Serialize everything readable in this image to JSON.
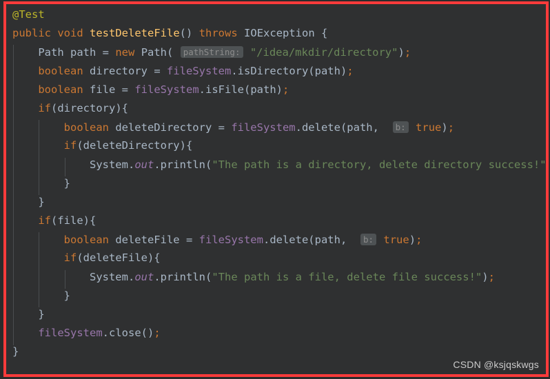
{
  "editor": {
    "language": "Java",
    "theme": "Darcula",
    "frame_color": "#fb3b3b",
    "background": "#2f3031",
    "page_background": "#2b2b2b"
  },
  "colors": {
    "annotation": "#bbb529",
    "keyword": "#cc7832",
    "method": "#ffc66d",
    "identifier": "#a9b7c6",
    "field": "#9876aa",
    "string": "#6a8759",
    "hint_background": "#4e5254",
    "hint_text": "#8c8c8c",
    "indent_guide": "#4b4e50"
  },
  "watermark": {
    "text": "CSDN @ksjqskwgs"
  },
  "code": {
    "lines": [
      {
        "indent": 0,
        "tokens": [
          {
            "t": "@Test",
            "c": "tok-annotation"
          }
        ]
      },
      {
        "indent": 0,
        "tokens": [
          {
            "t": "public",
            "c": "tok-keyword"
          },
          {
            "t": " ",
            "c": "tok-punct"
          },
          {
            "t": "void",
            "c": "tok-keyword"
          },
          {
            "t": " ",
            "c": "tok-punct"
          },
          {
            "t": "testDeleteFile",
            "c": "tok-method"
          },
          {
            "t": "()",
            "c": "tok-punct"
          },
          {
            "t": " ",
            "c": "tok-punct"
          },
          {
            "t": "throws",
            "c": "tok-keyword"
          },
          {
            "t": " ",
            "c": "tok-punct"
          },
          {
            "t": "IOException",
            "c": "tok-type"
          },
          {
            "t": " {",
            "c": "tok-punct"
          }
        ]
      },
      {
        "indent": 1,
        "tokens": [
          {
            "t": "Path",
            "c": "tok-type"
          },
          {
            "t": " path ",
            "c": "tok-ident"
          },
          {
            "t": "=",
            "c": "tok-op"
          },
          {
            "t": " ",
            "c": "tok-punct"
          },
          {
            "t": "new",
            "c": "tok-keyword"
          },
          {
            "t": " ",
            "c": "tok-punct"
          },
          {
            "t": "Path",
            "c": "tok-type"
          },
          {
            "t": "(",
            "c": "tok-punct"
          },
          {
            "t": " ",
            "c": "tok-punct"
          },
          {
            "t": "pathString:",
            "c": "hint"
          },
          {
            "t": " ",
            "c": "tok-punct"
          },
          {
            "t": "\"/idea/mkdir/directory\"",
            "c": "tok-string"
          },
          {
            "t": ")",
            "c": "tok-punct"
          },
          {
            "t": ";",
            "c": "tok-semi"
          }
        ]
      },
      {
        "indent": 1,
        "tokens": [
          {
            "t": "boolean",
            "c": "tok-keyword"
          },
          {
            "t": " directory ",
            "c": "tok-ident"
          },
          {
            "t": "=",
            "c": "tok-op"
          },
          {
            "t": " ",
            "c": "tok-punct"
          },
          {
            "t": "fileSystem",
            "c": "tok-field"
          },
          {
            "t": ".isDirectory(path)",
            "c": "tok-ident"
          },
          {
            "t": ";",
            "c": "tok-semi"
          }
        ]
      },
      {
        "indent": 1,
        "tokens": [
          {
            "t": "boolean",
            "c": "tok-keyword"
          },
          {
            "t": " file ",
            "c": "tok-ident"
          },
          {
            "t": "=",
            "c": "tok-op"
          },
          {
            "t": " ",
            "c": "tok-punct"
          },
          {
            "t": "fileSystem",
            "c": "tok-field"
          },
          {
            "t": ".isFile(path)",
            "c": "tok-ident"
          },
          {
            "t": ";",
            "c": "tok-semi"
          }
        ]
      },
      {
        "indent": 1,
        "tokens": [
          {
            "t": "if",
            "c": "tok-keyword"
          },
          {
            "t": "(directory){",
            "c": "tok-ident"
          }
        ]
      },
      {
        "indent": 2,
        "tokens": [
          {
            "t": "boolean",
            "c": "tok-keyword"
          },
          {
            "t": " deleteDirectory ",
            "c": "tok-ident"
          },
          {
            "t": "=",
            "c": "tok-op"
          },
          {
            "t": " ",
            "c": "tok-punct"
          },
          {
            "t": "fileSystem",
            "c": "tok-field"
          },
          {
            "t": ".delete(path,",
            "c": "tok-ident"
          },
          {
            "t": "  ",
            "c": "tok-punct"
          },
          {
            "t": "b:",
            "c": "hint"
          },
          {
            "t": " ",
            "c": "tok-punct"
          },
          {
            "t": "true",
            "c": "tok-keyword"
          },
          {
            "t": ")",
            "c": "tok-punct"
          },
          {
            "t": ";",
            "c": "tok-semi"
          }
        ]
      },
      {
        "indent": 2,
        "tokens": [
          {
            "t": "if",
            "c": "tok-keyword"
          },
          {
            "t": "(deleteDirectory){",
            "c": "tok-ident"
          }
        ]
      },
      {
        "indent": 3,
        "tokens": [
          {
            "t": "System",
            "c": "tok-ident"
          },
          {
            "t": ".",
            "c": "tok-punct"
          },
          {
            "t": "out",
            "c": "tok-static"
          },
          {
            "t": ".println(",
            "c": "tok-ident"
          },
          {
            "t": "\"The path is a directory, delete directory success!\"",
            "c": "tok-string"
          },
          {
            "t": ")",
            "c": "tok-punct"
          },
          {
            "t": ";",
            "c": "tok-semi"
          }
        ]
      },
      {
        "indent": 2,
        "tokens": [
          {
            "t": "}",
            "c": "tok-punct"
          }
        ]
      },
      {
        "indent": 1,
        "tokens": [
          {
            "t": "}",
            "c": "tok-punct"
          }
        ]
      },
      {
        "indent": 1,
        "tokens": [
          {
            "t": "if",
            "c": "tok-keyword"
          },
          {
            "t": "(file){",
            "c": "tok-ident"
          }
        ]
      },
      {
        "indent": 2,
        "tokens": [
          {
            "t": "boolean",
            "c": "tok-keyword"
          },
          {
            "t": " deleteFile ",
            "c": "tok-ident"
          },
          {
            "t": "=",
            "c": "tok-op"
          },
          {
            "t": " ",
            "c": "tok-punct"
          },
          {
            "t": "fileSystem",
            "c": "tok-field"
          },
          {
            "t": ".delete(path,",
            "c": "tok-ident"
          },
          {
            "t": "  ",
            "c": "tok-punct"
          },
          {
            "t": "b:",
            "c": "hint"
          },
          {
            "t": " ",
            "c": "tok-punct"
          },
          {
            "t": "true",
            "c": "tok-keyword"
          },
          {
            "t": ")",
            "c": "tok-punct"
          },
          {
            "t": ";",
            "c": "tok-semi"
          }
        ]
      },
      {
        "indent": 2,
        "tokens": [
          {
            "t": "if",
            "c": "tok-keyword"
          },
          {
            "t": "(deleteFile){",
            "c": "tok-ident"
          }
        ]
      },
      {
        "indent": 3,
        "tokens": [
          {
            "t": "System",
            "c": "tok-ident"
          },
          {
            "t": ".",
            "c": "tok-punct"
          },
          {
            "t": "out",
            "c": "tok-static"
          },
          {
            "t": ".println(",
            "c": "tok-ident"
          },
          {
            "t": "\"The path is a file, delete file success!\"",
            "c": "tok-string"
          },
          {
            "t": ")",
            "c": "tok-punct"
          },
          {
            "t": ";",
            "c": "tok-semi"
          }
        ]
      },
      {
        "indent": 2,
        "tokens": [
          {
            "t": "}",
            "c": "tok-punct"
          }
        ]
      },
      {
        "indent": 1,
        "tokens": [
          {
            "t": "}",
            "c": "tok-punct"
          }
        ]
      },
      {
        "indent": 1,
        "tokens": [
          {
            "t": "fileSystem",
            "c": "tok-field"
          },
          {
            "t": ".close()",
            "c": "tok-ident"
          },
          {
            "t": ";",
            "c": "tok-semi"
          }
        ]
      },
      {
        "indent": 0,
        "tokens": [
          {
            "t": "}",
            "c": "tok-punct"
          }
        ]
      }
    ],
    "indent_guides": [
      {
        "level": 1,
        "from_line": 2,
        "to_line": 17
      },
      {
        "level": 2,
        "from_line": 6,
        "to_line": 9
      },
      {
        "level": 2,
        "from_line": 12,
        "to_line": 15
      },
      {
        "level": 3,
        "from_line": 8,
        "to_line": 8
      },
      {
        "level": 3,
        "from_line": 14,
        "to_line": 14
      }
    ]
  }
}
